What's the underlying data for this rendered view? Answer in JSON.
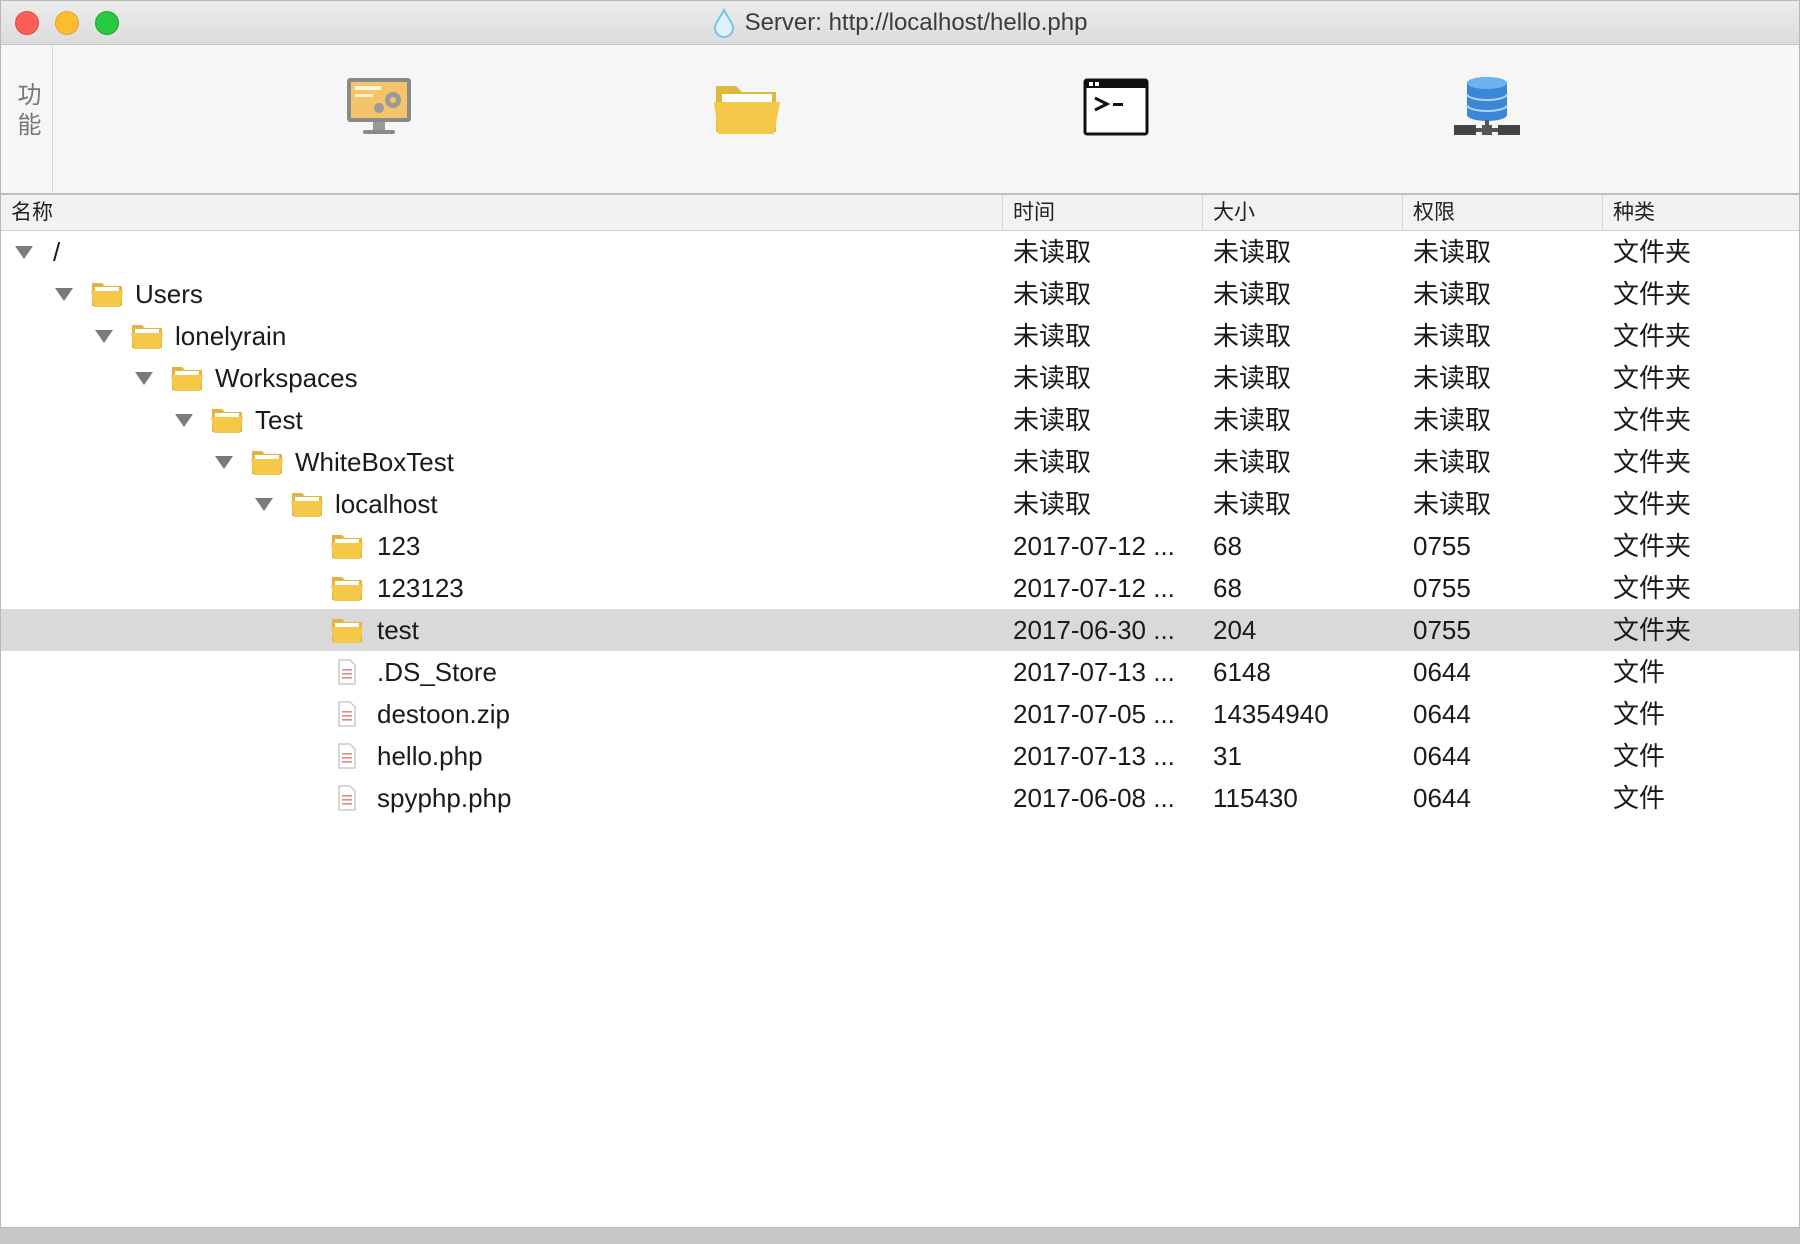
{
  "window": {
    "title": "Server: http://localhost/hello.php"
  },
  "toolbar": {
    "section_label": "功能",
    "tools": [
      {
        "icon": "monitor-icon"
      },
      {
        "icon": "folder-icon"
      },
      {
        "icon": "terminal-icon"
      },
      {
        "icon": "database-icon"
      }
    ]
  },
  "columns": {
    "name": "名称",
    "time": "时间",
    "size": "大小",
    "perm": "权限",
    "kind": "种类"
  },
  "colors": {
    "folder": "#f5c84a",
    "selected_row": "#d9d9d9",
    "database": "#3d86d6"
  },
  "rows": [
    {
      "name": "/",
      "time": "未读取",
      "size": "未读取",
      "perm": "未读取",
      "kind": "文件夹",
      "level": 0,
      "type": "root",
      "expanded": true,
      "selected": false
    },
    {
      "name": "Users",
      "time": "未读取",
      "size": "未读取",
      "perm": "未读取",
      "kind": "文件夹",
      "level": 1,
      "type": "folder",
      "expanded": true,
      "selected": false
    },
    {
      "name": "lonelyrain",
      "time": "未读取",
      "size": "未读取",
      "perm": "未读取",
      "kind": "文件夹",
      "level": 2,
      "type": "folder",
      "expanded": true,
      "selected": false
    },
    {
      "name": "Workspaces",
      "time": "未读取",
      "size": "未读取",
      "perm": "未读取",
      "kind": "文件夹",
      "level": 3,
      "type": "folder",
      "expanded": true,
      "selected": false
    },
    {
      "name": "Test",
      "time": "未读取",
      "size": "未读取",
      "perm": "未读取",
      "kind": "文件夹",
      "level": 4,
      "type": "folder",
      "expanded": true,
      "selected": false
    },
    {
      "name": "WhiteBoxTest",
      "time": "未读取",
      "size": "未读取",
      "perm": "未读取",
      "kind": "文件夹",
      "level": 5,
      "type": "folder",
      "expanded": true,
      "selected": false
    },
    {
      "name": "localhost",
      "time": "未读取",
      "size": "未读取",
      "perm": "未读取",
      "kind": "文件夹",
      "level": 6,
      "type": "folder",
      "expanded": true,
      "selected": false
    },
    {
      "name": "123",
      "time": "2017-07-12 ...",
      "size": "68",
      "perm": "0755",
      "kind": "文件夹",
      "level": 7,
      "type": "folder",
      "expanded": false,
      "selected": false
    },
    {
      "name": "123123",
      "time": "2017-07-12 ...",
      "size": "68",
      "perm": "0755",
      "kind": "文件夹",
      "level": 7,
      "type": "folder",
      "expanded": false,
      "selected": false
    },
    {
      "name": "test",
      "time": "2017-06-30 ...",
      "size": "204",
      "perm": "0755",
      "kind": "文件夹",
      "level": 7,
      "type": "folder",
      "expanded": false,
      "selected": true
    },
    {
      "name": ".DS_Store",
      "time": "2017-07-13 ...",
      "size": "6148",
      "perm": "0644",
      "kind": "文件",
      "level": 7,
      "type": "file",
      "expanded": false,
      "selected": false
    },
    {
      "name": "destoon.zip",
      "time": "2017-07-05 ...",
      "size": "14354940",
      "perm": "0644",
      "kind": "文件",
      "level": 7,
      "type": "file",
      "expanded": false,
      "selected": false
    },
    {
      "name": "hello.php",
      "time": "2017-07-13 ...",
      "size": "31",
      "perm": "0644",
      "kind": "文件",
      "level": 7,
      "type": "file",
      "expanded": false,
      "selected": false
    },
    {
      "name": "spyphp.php",
      "time": "2017-06-08 ...",
      "size": "115430",
      "perm": "0644",
      "kind": "文件",
      "level": 7,
      "type": "file",
      "expanded": false,
      "selected": false
    }
  ]
}
